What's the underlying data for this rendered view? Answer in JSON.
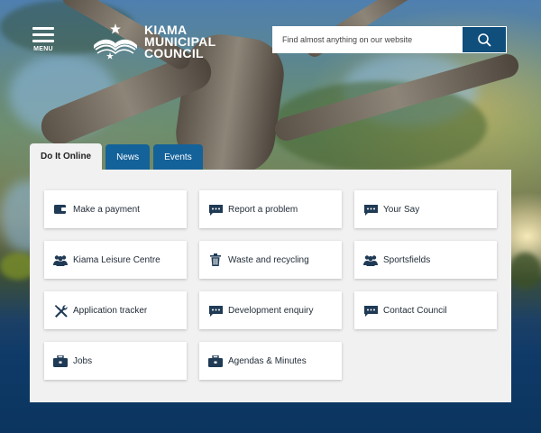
{
  "header": {
    "menu_label": "MENU",
    "logo_lines": [
      "KIAMA",
      "MUNICIPAL",
      "COUNCIL"
    ],
    "search_placeholder": "Find almost anything on our website"
  },
  "tabs": [
    {
      "label": "Do It Online",
      "active": true
    },
    {
      "label": "News",
      "active": false
    },
    {
      "label": "Events",
      "active": false
    }
  ],
  "tiles": [
    {
      "label": "Make a payment",
      "icon": "wallet-icon"
    },
    {
      "label": "Report a problem",
      "icon": "chat-icon"
    },
    {
      "label": "Your Say",
      "icon": "chat-icon"
    },
    {
      "label": "Kiama Leisure Centre",
      "icon": "people-icon"
    },
    {
      "label": "Waste and recycling",
      "icon": "trash-icon"
    },
    {
      "label": "Sportsfields",
      "icon": "people-icon"
    },
    {
      "label": "Application tracker",
      "icon": "tools-icon"
    },
    {
      "label": "Development enquiry",
      "icon": "chat-icon"
    },
    {
      "label": "Contact Council",
      "icon": "chat-icon"
    },
    {
      "label": "Jobs",
      "icon": "briefcase-icon"
    },
    {
      "label": "Agendas & Minutes",
      "icon": "briefcase-icon"
    }
  ],
  "colors": {
    "brand": "#104e7c",
    "tab_inactive": "#14629a",
    "icon": "#1f3a55"
  }
}
